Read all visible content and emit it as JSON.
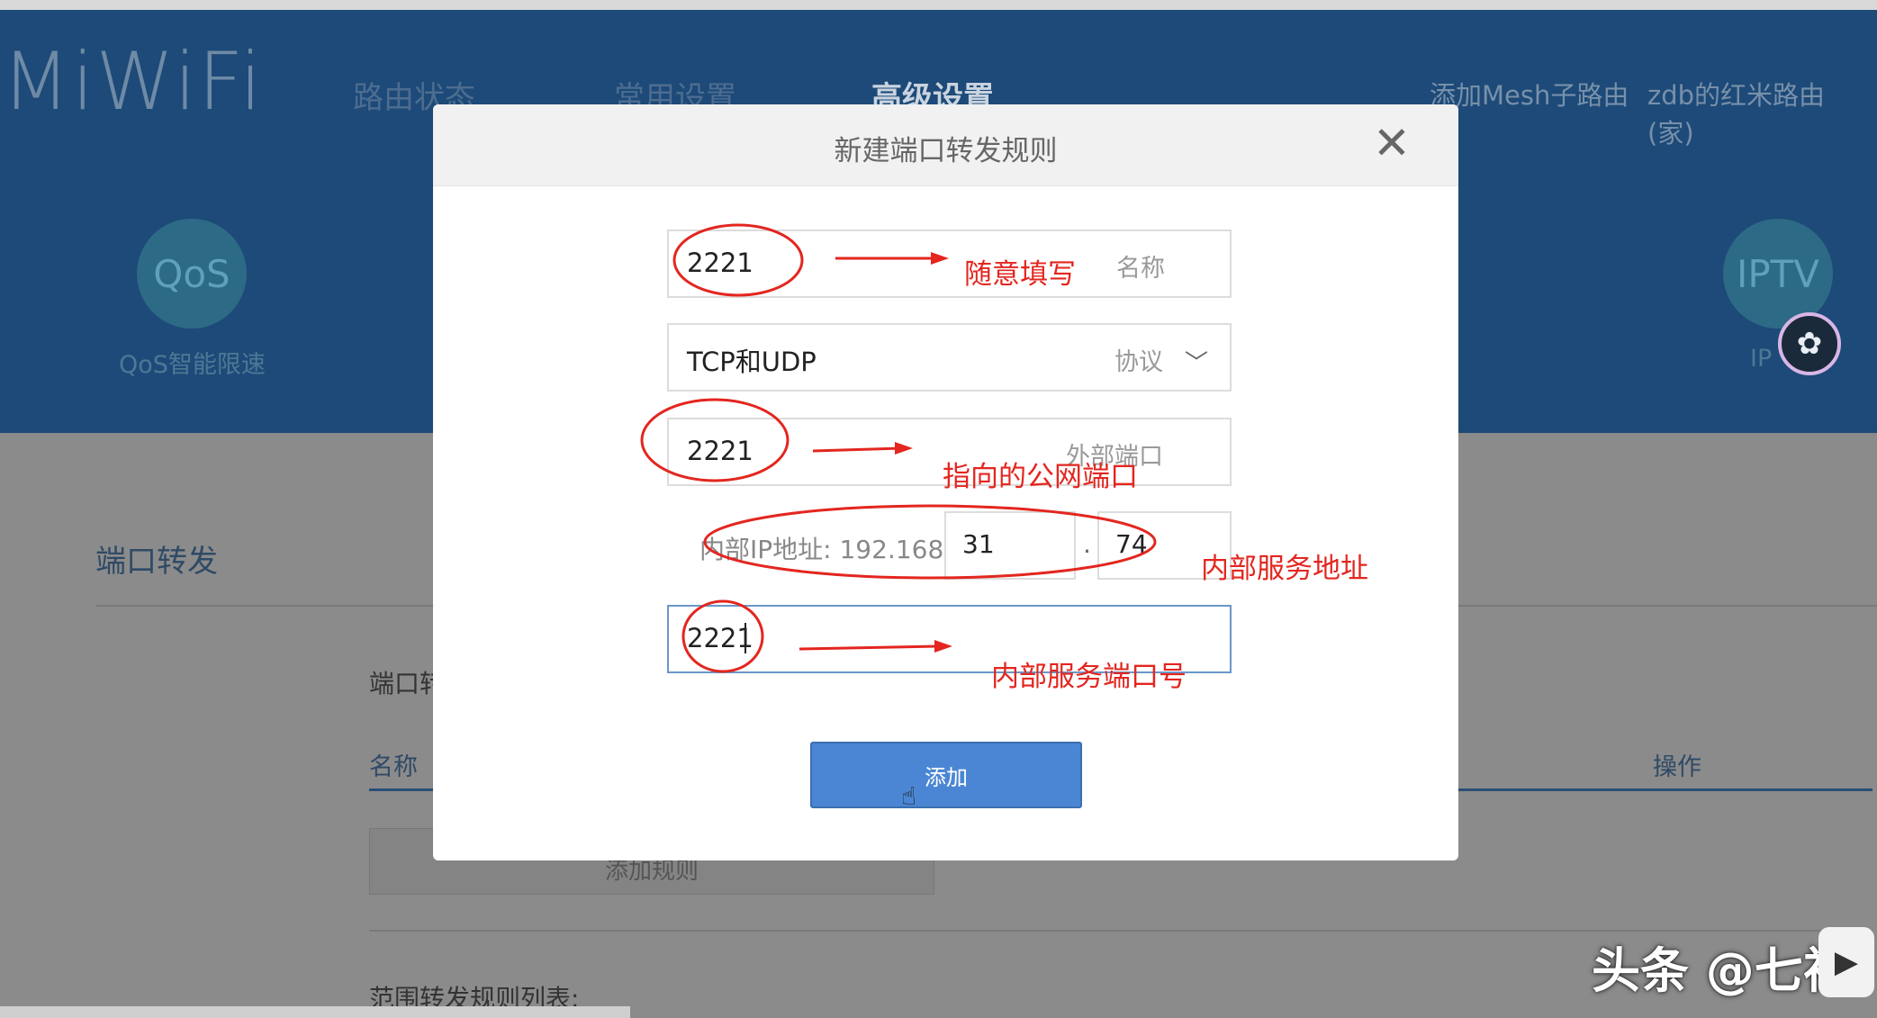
{
  "header": {
    "logo": "MiWiFi",
    "nav": [
      "路由状态",
      "常用设置",
      "高级设置"
    ],
    "active_nav": "高级设置",
    "right_links": [
      "添加Mesh子路由",
      "zdb的红米路由 (家)"
    ],
    "features": [
      {
        "icon_text": "QoS",
        "label": "QoS智能限速"
      },
      {
        "icon_text": "IPTV",
        "label": "IP"
      }
    ]
  },
  "page": {
    "section_title": "端口转发",
    "sub_heading": "端口转",
    "col_name": "名称",
    "col_action": "操作",
    "add_rule_label": "添加规则",
    "range_list_title": "范围转发规则列表:"
  },
  "modal": {
    "title": "新建端口转发规则",
    "close_icon": "close-icon",
    "name_value": "2221",
    "name_placeholder": "名称",
    "protocol_value": "TCP和UDP",
    "protocol_label": "协议",
    "external_port_value": "2221",
    "external_port_placeholder": "外部端口",
    "ip_label": "内部IP地址: 192.168.",
    "ip_part3": "31",
    "ip_dot": ".",
    "ip_part4": "74",
    "internal_port_value": "2221",
    "add_button": "添加"
  },
  "annotations": {
    "name": "随意填写",
    "external_port": "指向的公网端口",
    "internal_ip": "内部服务地址",
    "internal_port": "内部服务端口号"
  },
  "watermark": "头条 @七视",
  "colors": {
    "header_bg": "#1d4a78",
    "primary_button": "#4a86d4",
    "annotation_red": "#e3261f"
  }
}
